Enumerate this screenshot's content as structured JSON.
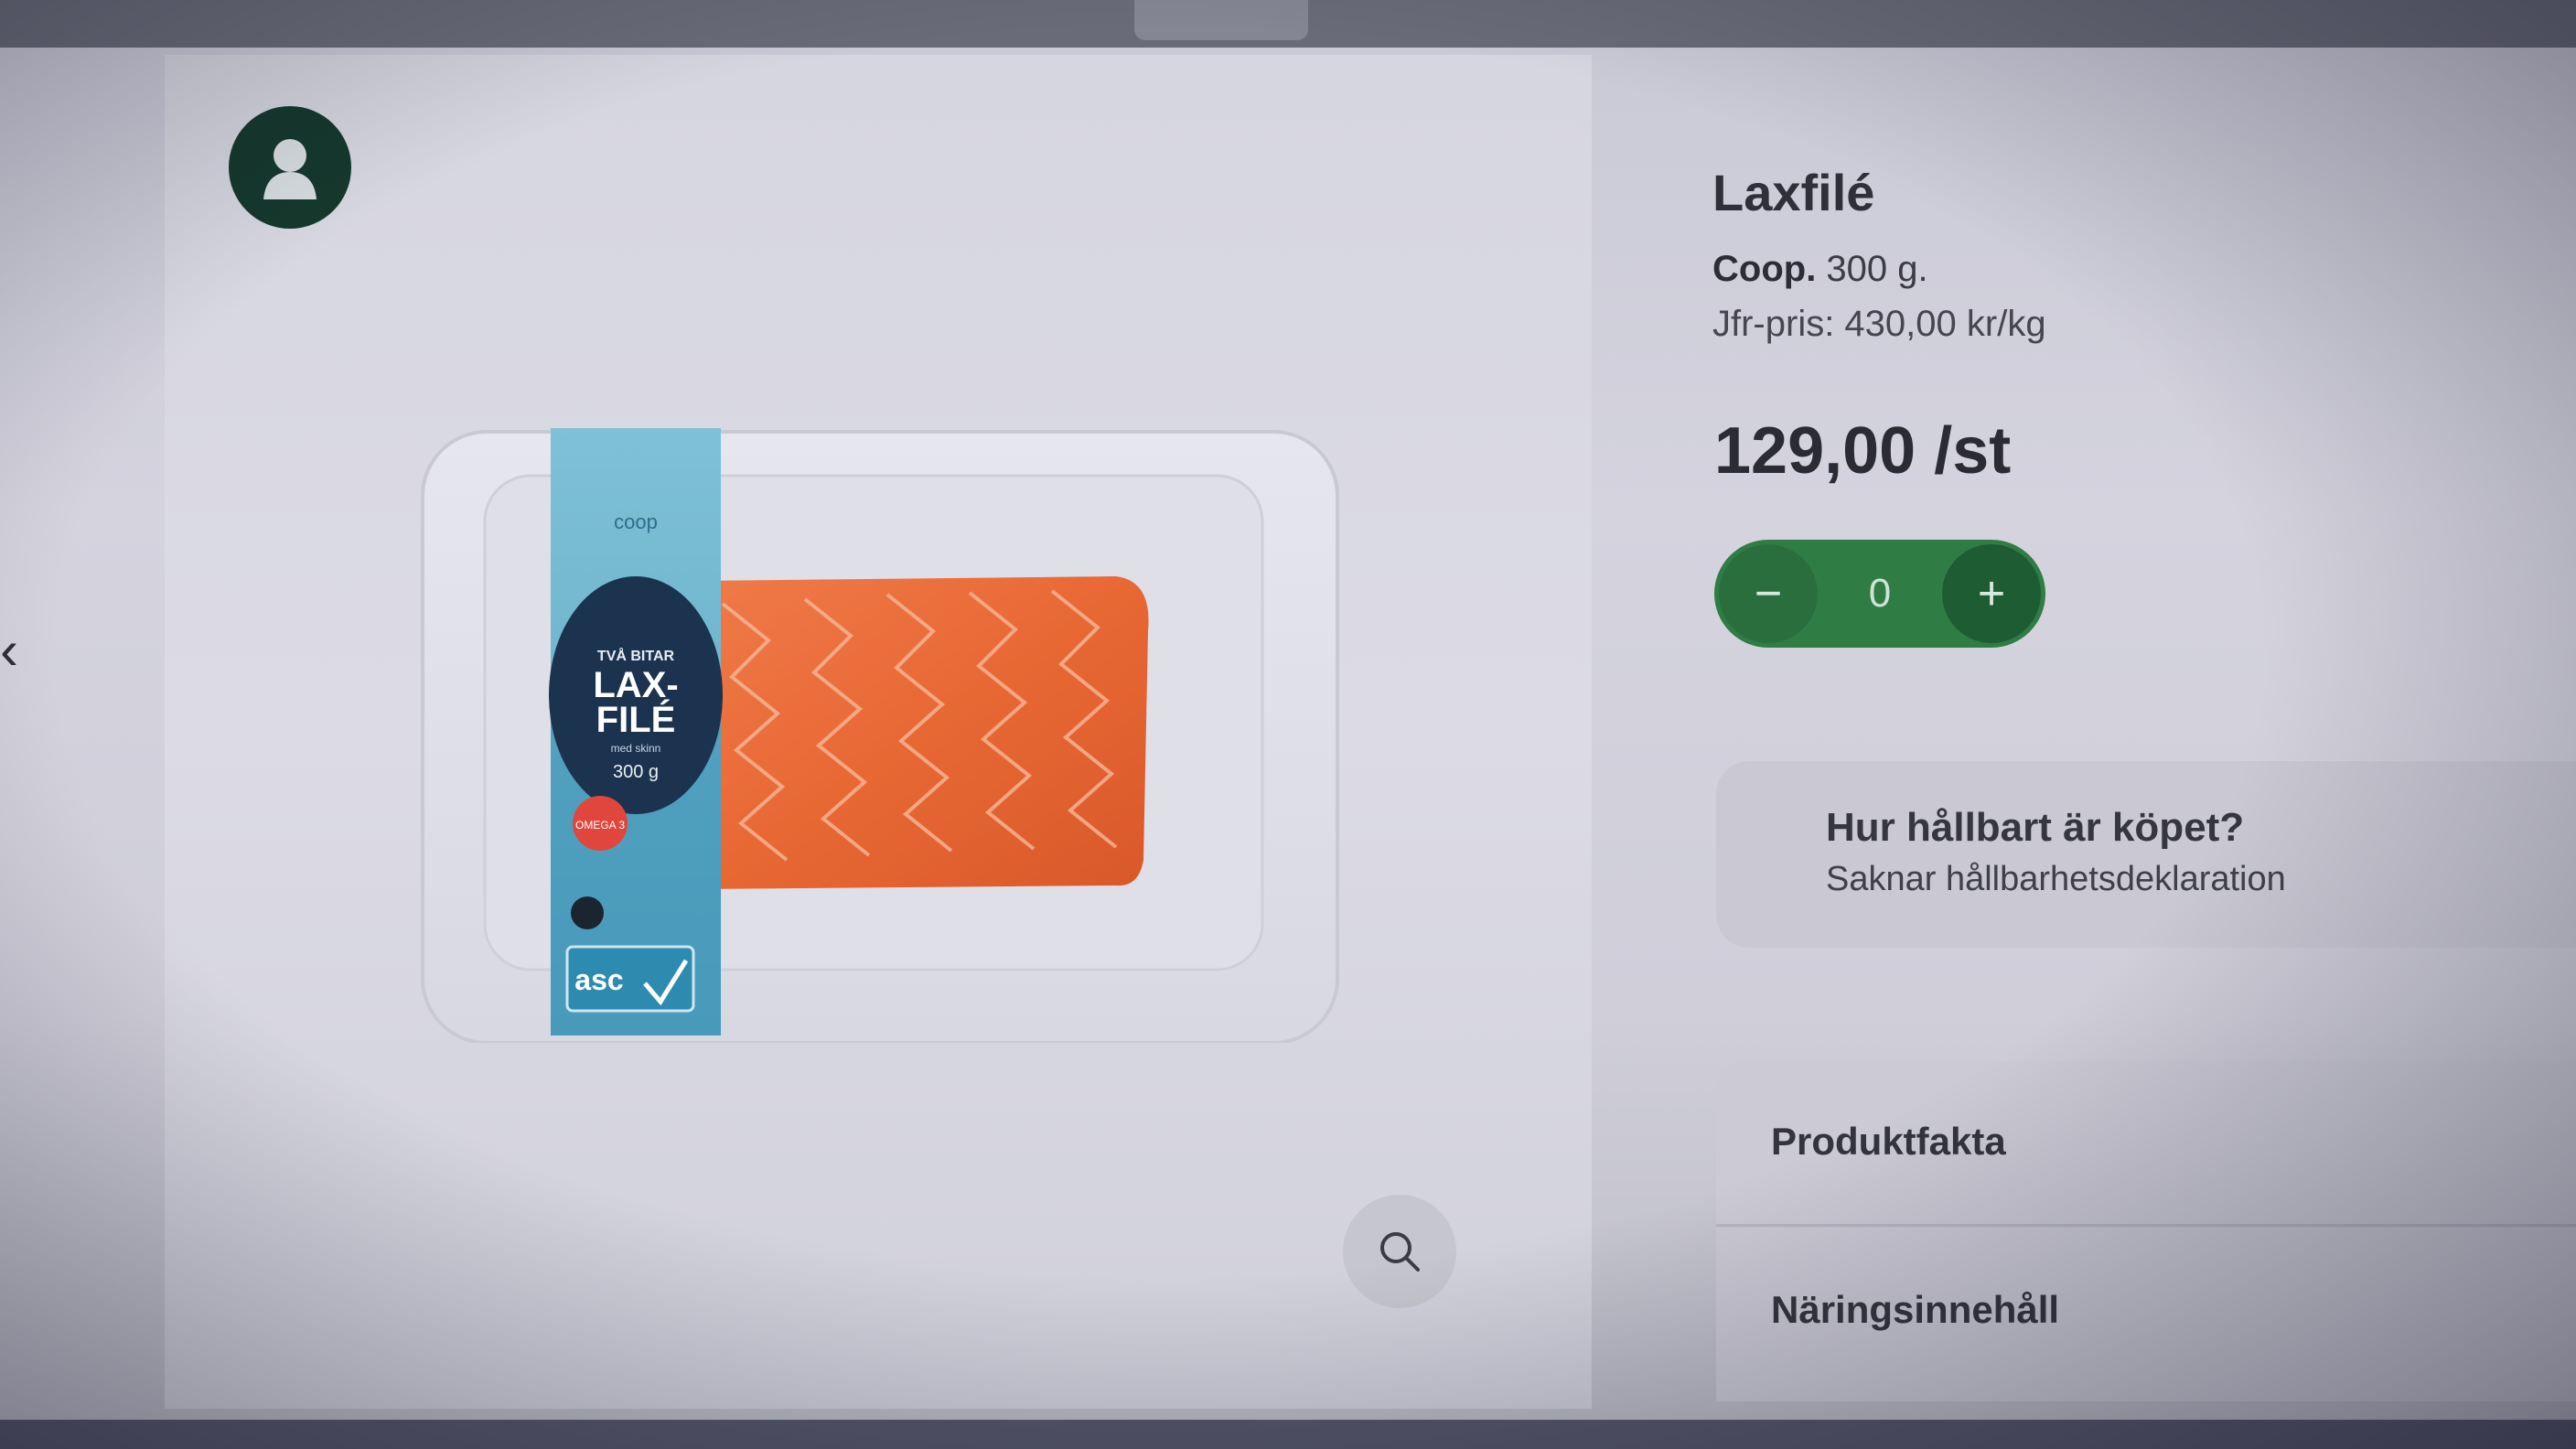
{
  "colors": {
    "accent_green": "#2f7d45",
    "avatar_green": "#15382c",
    "text_dark": "#2f3039"
  },
  "icons": {
    "avatar": "user-silhouette-icon",
    "zoom": "search-icon",
    "minus": "minus-icon",
    "plus": "plus-icon"
  },
  "product": {
    "title": "Laxfilé",
    "brand": "Coop.",
    "size": " 300 g.",
    "compare_price": "Jfr-pris: 430,00 kr/kg",
    "price": "129,00 /st",
    "quantity": "0",
    "package": {
      "brand_mark": "coop",
      "line1": "TVÅ BITAR",
      "line2": "LAX-",
      "line3": "FILÉ",
      "line4": "med skinn",
      "weight": "300 g",
      "badge": "OMEGA 3",
      "cert": "asc"
    }
  },
  "stepper": {
    "minus_label": "−",
    "plus_label": "+"
  },
  "sustainability": {
    "title": "Hur hållbart är köpet?",
    "subtitle": "Saknar hållbarhetsdeklaration"
  },
  "sections": [
    {
      "label": "Produktfakta"
    },
    {
      "label": "Näringsinnehåll"
    }
  ]
}
